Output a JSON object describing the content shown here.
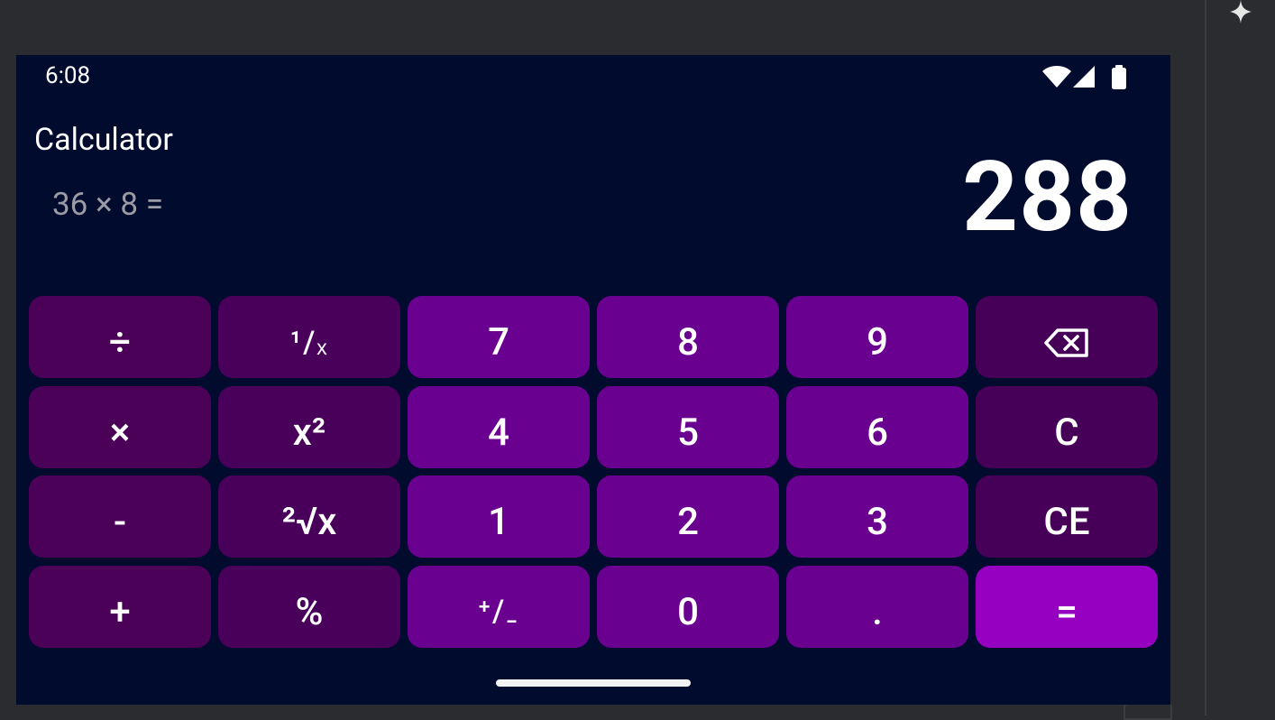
{
  "status_bar": {
    "time": "6:08",
    "icons": [
      "wifi-icon",
      "cellular-signal-icon",
      "battery-icon"
    ]
  },
  "app": {
    "title": "Calculator"
  },
  "display": {
    "expression": "36 × 8 =",
    "result": "288"
  },
  "keypad": {
    "rows": [
      [
        {
          "label": "÷",
          "type": "op"
        },
        {
          "label": "¹/ₓ",
          "type": "fn"
        },
        {
          "label": "7",
          "type": "num"
        },
        {
          "label": "8",
          "type": "num"
        },
        {
          "label": "9",
          "type": "num"
        },
        {
          "label": "",
          "icon": "backspace-icon",
          "type": "ctl"
        }
      ],
      [
        {
          "label": "×",
          "type": "op"
        },
        {
          "label": "x²",
          "type": "fn"
        },
        {
          "label": "4",
          "type": "num"
        },
        {
          "label": "5",
          "type": "num"
        },
        {
          "label": "6",
          "type": "num"
        },
        {
          "label": "C",
          "type": "ctl"
        }
      ],
      [
        {
          "label": "-",
          "type": "op"
        },
        {
          "label": "²√x",
          "type": "fn"
        },
        {
          "label": "1",
          "type": "num"
        },
        {
          "label": "2",
          "type": "num"
        },
        {
          "label": "3",
          "type": "num"
        },
        {
          "label": "CE",
          "type": "ctl"
        }
      ],
      [
        {
          "label": "+",
          "type": "op"
        },
        {
          "label": "%",
          "type": "fn"
        },
        {
          "label": "⁺/₋",
          "type": "num"
        },
        {
          "label": "0",
          "type": "num"
        },
        {
          "label": ".",
          "type": "num"
        },
        {
          "label": "=",
          "type": "eq"
        }
      ]
    ]
  },
  "colors": {
    "background": "#000b2e",
    "operator_key": "#4b0158",
    "function_key": "#48005b",
    "number_key": "#6a0090",
    "control_key": "#460057",
    "equals_key": "#9600c0",
    "expression_text": "#9c9ca6",
    "text": "#ffffff"
  }
}
